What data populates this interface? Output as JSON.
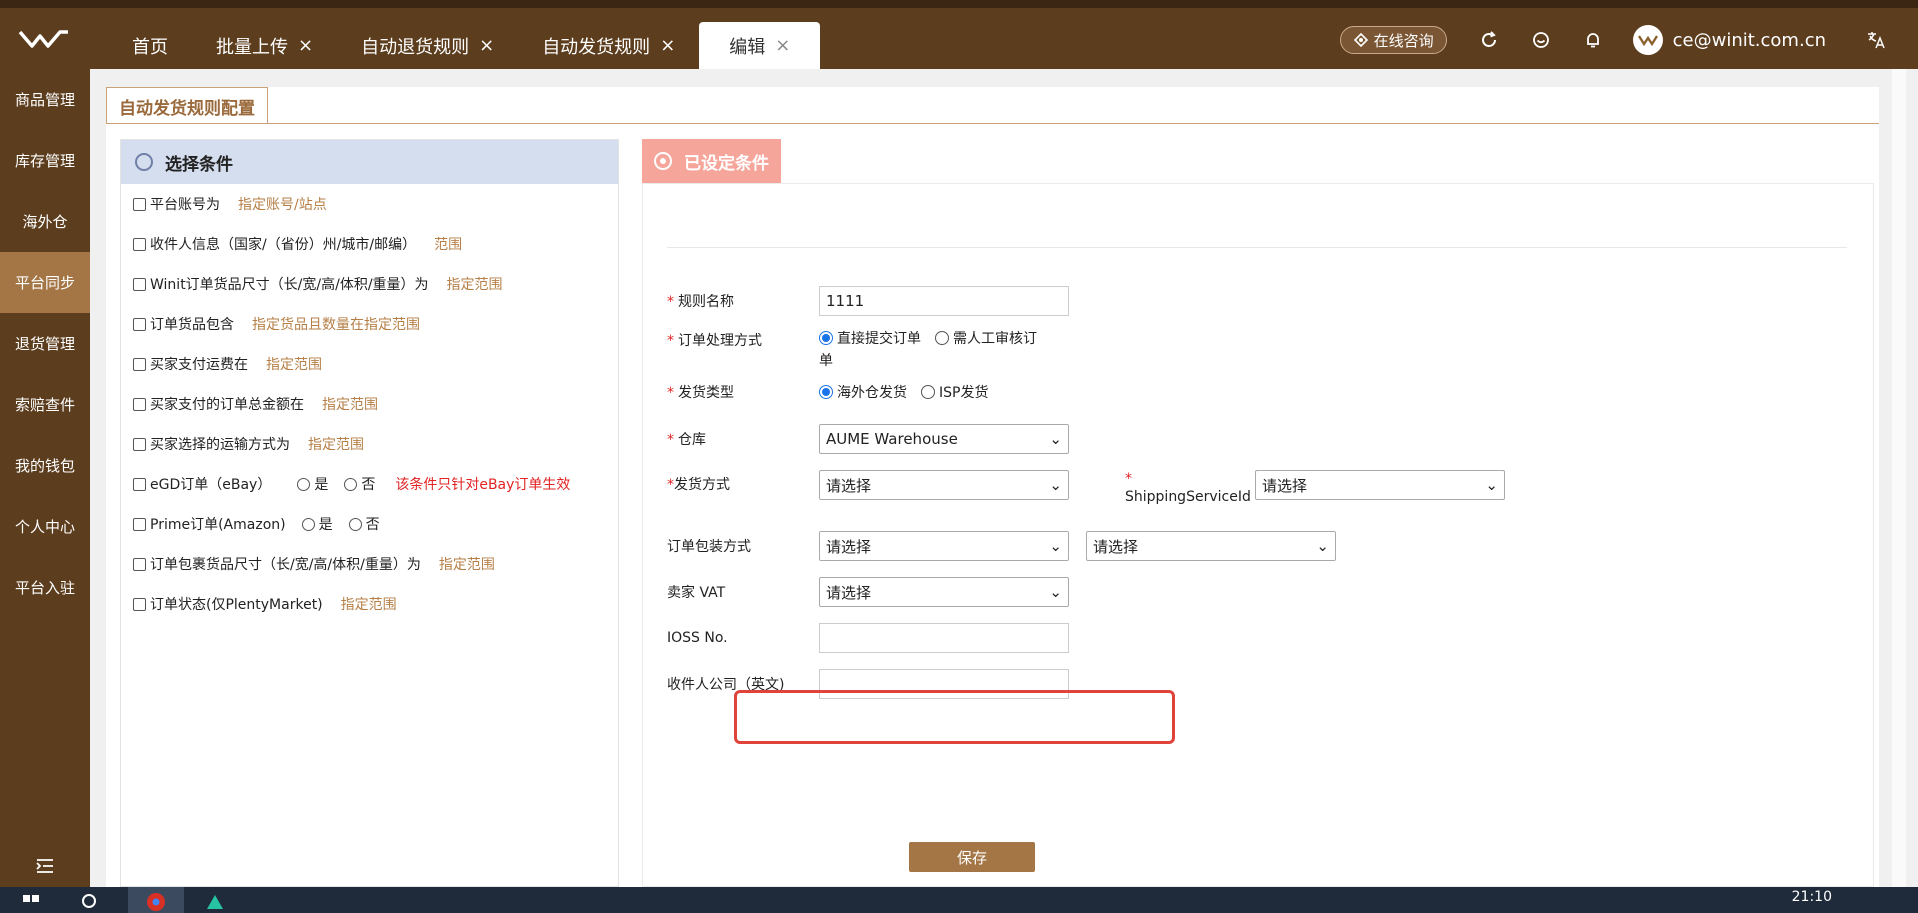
{
  "topbar": {
    "tabs": [
      {
        "label": "首页",
        "closable": false
      },
      {
        "label": "批量上传",
        "closable": true
      },
      {
        "label": "自动退货规则",
        "closable": true
      },
      {
        "label": "自动发货规则",
        "closable": true
      },
      {
        "label": "编辑",
        "closable": true,
        "active": true
      }
    ],
    "consult_label": "在线咨询",
    "user_email": "ce@winit.com.cn"
  },
  "sidebar": {
    "items": [
      {
        "label": "商品管理"
      },
      {
        "label": "库存管理"
      },
      {
        "label": "海外仓"
      },
      {
        "label": "平台同步",
        "active": true
      },
      {
        "label": "退货管理"
      },
      {
        "label": "索赔查件"
      },
      {
        "label": "我的钱包"
      },
      {
        "label": "个人中心"
      },
      {
        "label": "平台入驻"
      }
    ]
  },
  "page": {
    "tab_label": "自动发货规则配置",
    "left": {
      "title": "选择条件",
      "conditions": [
        {
          "text": "平台账号为",
          "link": "指定账号/站点"
        },
        {
          "text": "收件人信息（国家/（省份）州/城市/邮编）",
          "link": "范围"
        },
        {
          "text": "Winit订单货品尺寸（长/宽/高/体积/重量）为",
          "link": "指定范围"
        },
        {
          "text": "订单货品包含",
          "link": "指定货品且数量在指定范围"
        },
        {
          "text": "买家支付运费在",
          "link": "指定范围"
        },
        {
          "text": "买家支付的订单总金额在",
          "link": "指定范围"
        },
        {
          "text": "买家选择的运输方式为",
          "link": "指定范围"
        },
        {
          "text": "eGD订单（eBay）",
          "opt_yes": "是",
          "opt_no": "否",
          "warn": "该条件只针对eBay订单生效"
        },
        {
          "text": "Prime订单(Amazon)",
          "opt_yes": "是",
          "opt_no": "否"
        },
        {
          "text": "订单包裹货品尺寸（长/宽/高/体积/重量）为",
          "link": "指定范围"
        },
        {
          "text": "订单状态(仅PlentyMarket)",
          "link": "指定范围"
        }
      ]
    },
    "right": {
      "title": "已设定条件",
      "rule_name_label": "规则名称",
      "rule_name_value": "1111",
      "process_label": "订单处理方式",
      "process_opt1": "直接提交订单",
      "process_opt2": "需人工审核订",
      "process_opt2_wrap": "单",
      "ship_type_label": "发货类型",
      "ship_type_opt1": "海外仓发货",
      "ship_type_opt2": "ISP发货",
      "warehouse_label": "仓库",
      "warehouse_value": "AUME Warehouse",
      "ship_method_label": "发货方式",
      "ship_method_value": "请选择",
      "shipping_service_label": "ShippingServiceId",
      "shipping_service_value": "请选择",
      "package_label": "订单包装方式",
      "package_value1": "请选择",
      "package_value2": "请选择",
      "vat_label": "卖家 VAT",
      "vat_value": "请选择",
      "ioss_label": "IOSS No.",
      "company_label": "收件人公司（英文)",
      "save_label": "保存"
    }
  },
  "taskbar": {
    "time": "21:10"
  }
}
